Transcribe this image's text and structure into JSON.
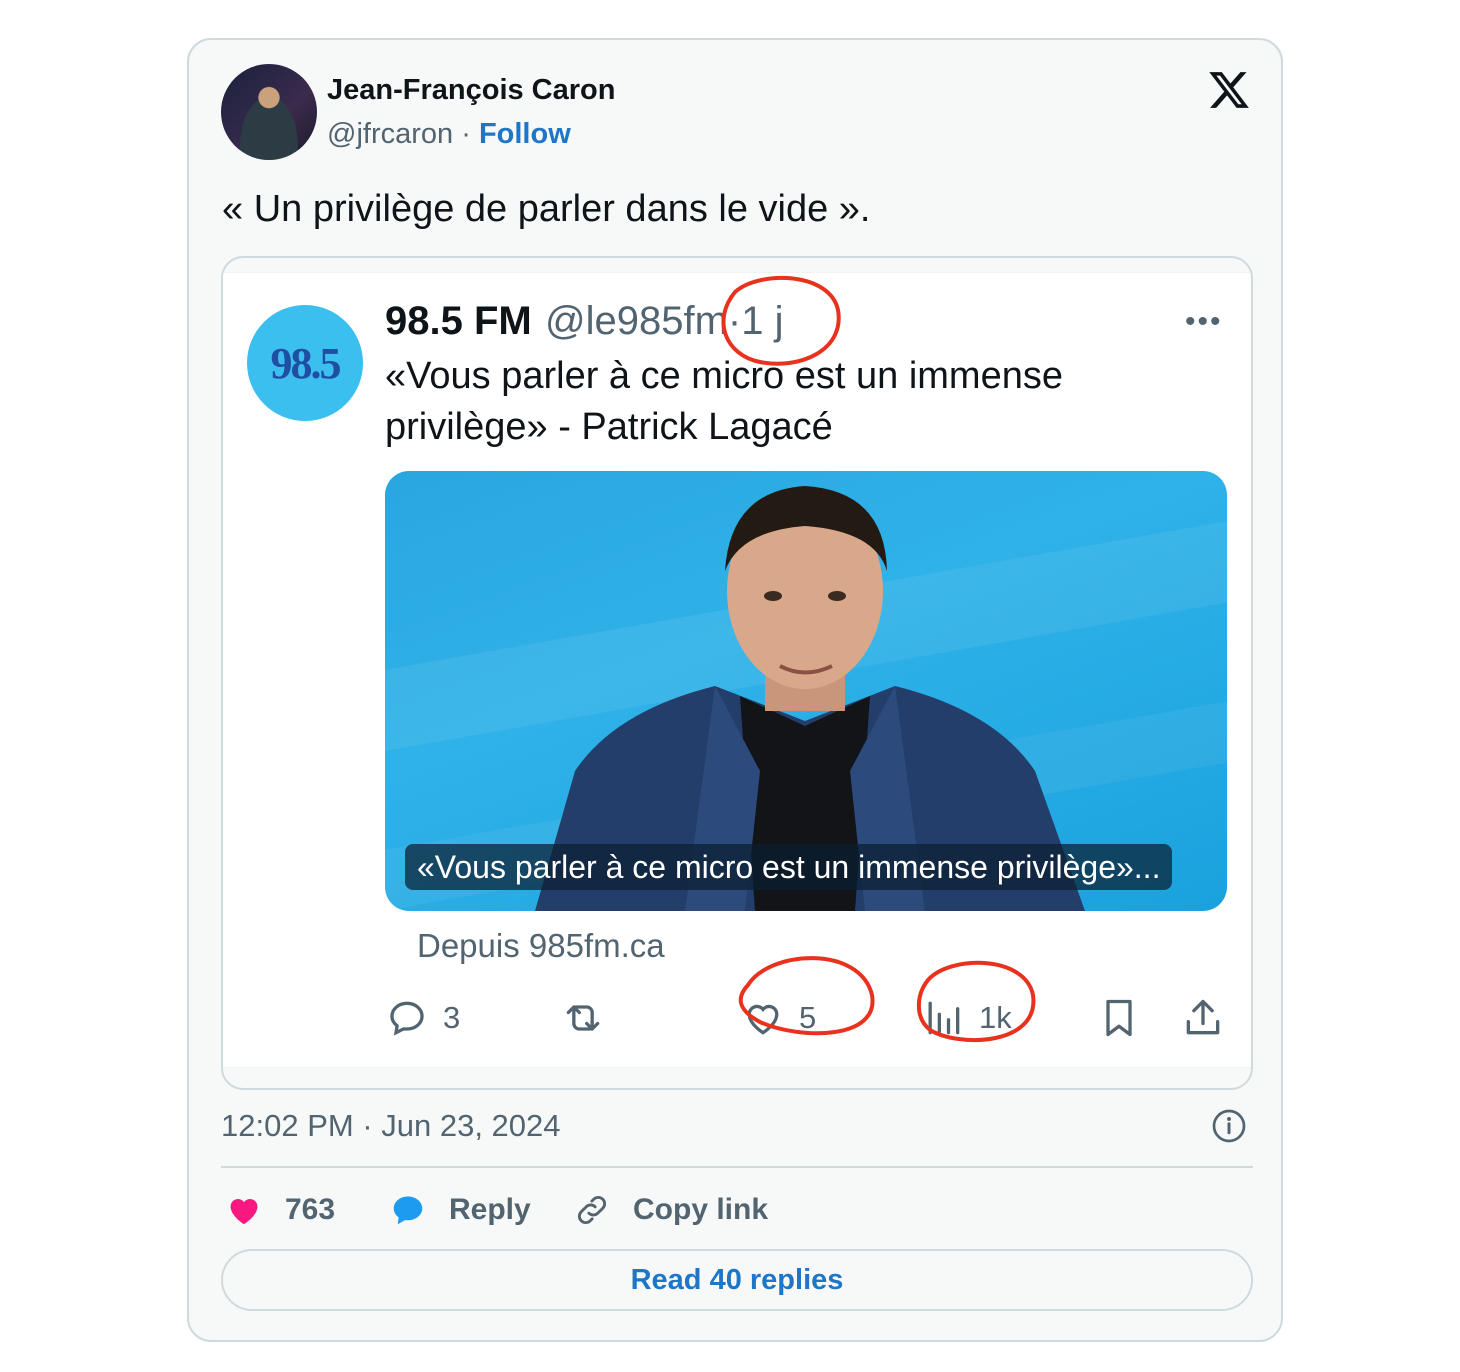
{
  "author": {
    "name": "Jean-François Caron",
    "handle": "@jfrcaron",
    "separator": "·",
    "follow_label": "Follow"
  },
  "tweet": {
    "text": "« Un privilège de parler dans le vide »."
  },
  "quoted": {
    "avatar_text": "98.5",
    "name": "98.5 FM",
    "handle": "@le985fm",
    "separator": "·",
    "age": "1 j",
    "more": "•••",
    "text": "«Vous parler à ce micro est un immense privilège» - Patrick Lagacé",
    "media_caption": "«Vous parler à ce micro est un immense privilège»...",
    "media_source": "Depuis 985fm.ca",
    "replies": "3",
    "likes": "5",
    "views": "1k"
  },
  "meta": {
    "timestamp": "12:02 PM · Jun 23, 2024"
  },
  "footer": {
    "like_count": "763",
    "reply_label": "Reply",
    "copy_label": "Copy link",
    "read_replies_label": "Read 40 replies"
  },
  "colors": {
    "accent": "#1d76c8",
    "like_pink": "#f91880",
    "reply_blue": "#1d9bf0",
    "annotation_red": "#e8321e",
    "muted": "#536471"
  }
}
